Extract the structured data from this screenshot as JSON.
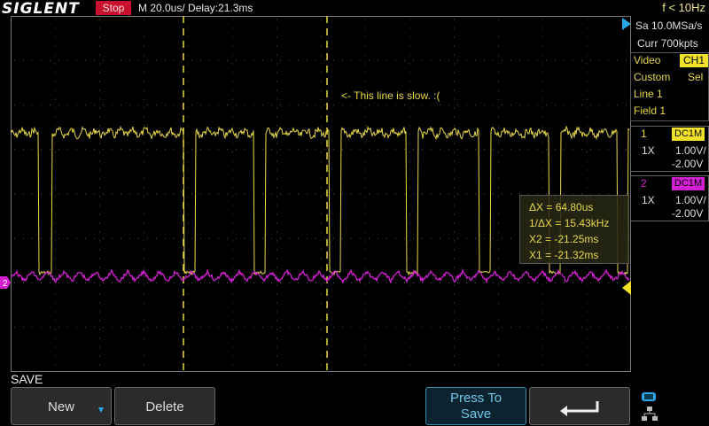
{
  "header": {
    "brand": "SIGLENT",
    "run_state": "Stop",
    "timebase": "M 20.0us/",
    "delay": "Delay:21.3ms",
    "trigger_frequency": "f < 10Hz"
  },
  "acquisition": {
    "sample_rate": "Sa 10.0MSa/s",
    "memory_depth": "Curr 700kpts"
  },
  "trigger": {
    "mode": "Video",
    "source": "CH1",
    "standard": "Custom",
    "sel": "Sel",
    "line": "Line 1",
    "field": "Field 1"
  },
  "channels": [
    {
      "num": "1",
      "coupling": "DC1M",
      "probe": "1X",
      "scale": "1.00V/",
      "offset": "-2.00V",
      "color": "#f2e12b"
    },
    {
      "num": "2",
      "coupling": "DC1M",
      "probe": "1X",
      "scale": "1.00V/",
      "offset": "-2.00V",
      "color": "#d21fd2"
    }
  ],
  "cursors": {
    "delta_x": "ΔX = 64.80us",
    "inv_delta_x": "1/ΔX = 15.43kHz",
    "x2": "X2 = -21.25ms",
    "x1": "X1 = -21.32ms"
  },
  "annotation": "<- This line is slow. :(",
  "menu": {
    "title": "SAVE",
    "new_label": "New",
    "delete_label": "Delete",
    "press_to_save_line1": "Press To",
    "press_to_save_line2": "Save"
  },
  "icons": {
    "new_arrow": "arrow-down-icon",
    "back": "return-arrow-icon",
    "network": "network-icon",
    "trigger_level_marker": "trigger-level-marker-icon",
    "ch2_marker": "ch2-ground-marker-icon"
  }
}
